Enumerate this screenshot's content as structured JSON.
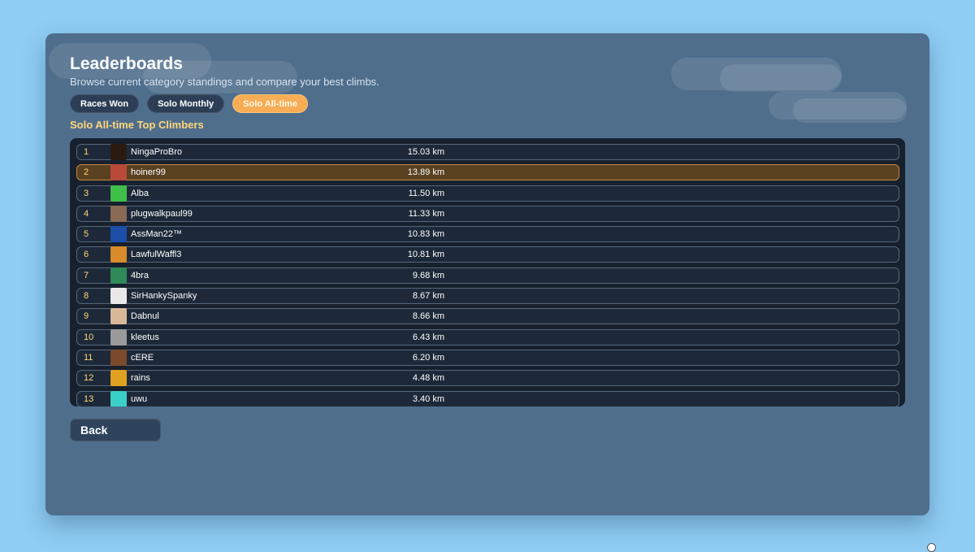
{
  "header": {
    "title": "Leaderboards",
    "subtitle": "Browse current category standings and compare your best climbs."
  },
  "tabs": [
    {
      "label": "Races Won",
      "active": false
    },
    {
      "label": "Solo Monthly",
      "active": false
    },
    {
      "label": "Solo All-time",
      "active": true
    }
  ],
  "section_title": "Solo All-time Top Climbers",
  "rows": [
    {
      "rank": "1",
      "name": "NingaProBro",
      "distance": "15.03 km",
      "avatar_color": "#2a1a10",
      "highlight": false
    },
    {
      "rank": "2",
      "name": "hoiner99",
      "distance": "13.89 km",
      "avatar_color": "#b84a3a",
      "highlight": true
    },
    {
      "rank": "3",
      "name": "Alba",
      "distance": "11.50 km",
      "avatar_color": "#3fbf4a",
      "highlight": false
    },
    {
      "rank": "4",
      "name": "plugwalkpaul99",
      "distance": "11.33 km",
      "avatar_color": "#8a6a55",
      "highlight": false
    },
    {
      "rank": "5",
      "name": "AssMan22™",
      "distance": "10.83 km",
      "avatar_color": "#1d4fa8",
      "highlight": false
    },
    {
      "rank": "6",
      "name": "LawfulWaffl3",
      "distance": "10.81 km",
      "avatar_color": "#d98a2a",
      "highlight": false
    },
    {
      "rank": "7",
      "name": "4bra",
      "distance": "9.68 km",
      "avatar_color": "#2f8a5a",
      "highlight": false
    },
    {
      "rank": "8",
      "name": "SirHankySpanky",
      "distance": "8.67 km",
      "avatar_color": "#e8e8e8",
      "highlight": false
    },
    {
      "rank": "9",
      "name": "Dabnul",
      "distance": "8.66 km",
      "avatar_color": "#d9b89a",
      "highlight": false
    },
    {
      "rank": "10",
      "name": "kleetus",
      "distance": "6.43 km",
      "avatar_color": "#9a9a9a",
      "highlight": false
    },
    {
      "rank": "11",
      "name": "cERE",
      "distance": "6.20 km",
      "avatar_color": "#7a4a2a",
      "highlight": false
    },
    {
      "rank": "12",
      "name": "rains",
      "distance": "4.48 km",
      "avatar_color": "#e0a020",
      "highlight": false
    },
    {
      "rank": "13",
      "name": "uwu",
      "distance": "3.40 km",
      "avatar_color": "#3ad0c8",
      "highlight": false
    }
  ],
  "back_label": "Back"
}
